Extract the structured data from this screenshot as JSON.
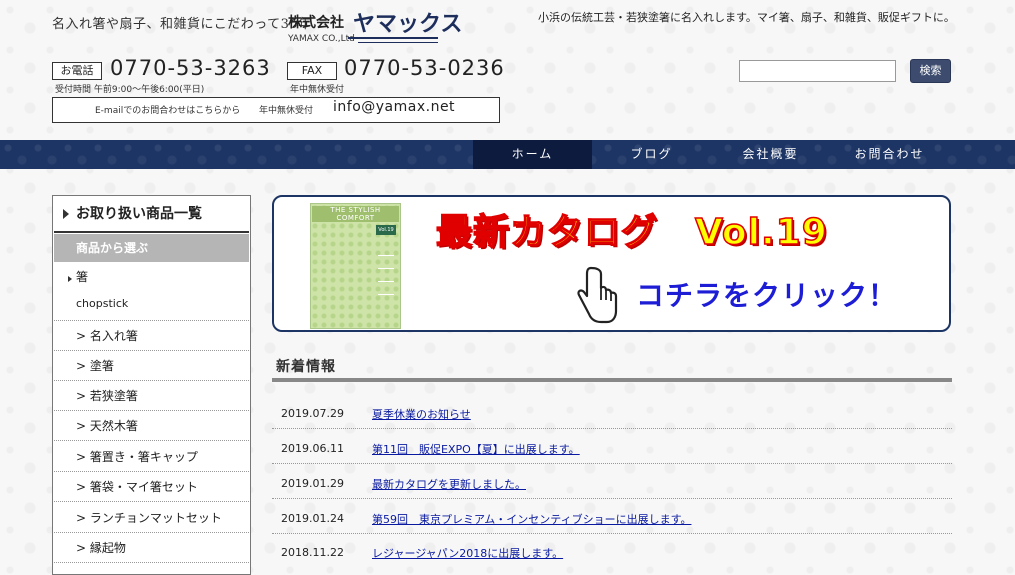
{
  "header": {
    "tagline_logo": "名入れ箸や扇子、和雑貨にこだわって35年",
    "company_prefix": "株式会社",
    "company_kana": "ヤマックス",
    "company_en": "YAMAX CO.,Ltd",
    "site_tagline": "小浜の伝統工芸・若狭塗箸に名入れします。マイ箸、扇子、和雑貨、販促ギフトに。",
    "tel_label": "お電話",
    "tel_number": "0770-53-3263",
    "tel_hours": "受付時間 午前9:00〜午後6:00(平日)",
    "fax_label": "FAX",
    "fax_number": "0770-53-0236",
    "fax_hours": "年中無休受付",
    "email_note": "E-mailでのお問合わせはこちらから",
    "email_hours": "年中無休受付",
    "email_address": "info@yamax.net",
    "search_button": "検索",
    "search_value": ""
  },
  "nav": {
    "items": [
      "ホーム",
      "ブログ",
      "会社概要",
      "お問合わせ"
    ]
  },
  "sidebar": {
    "heading": "お取り扱い商品一覧",
    "subheading": "商品から選ぶ",
    "category": "箸",
    "category_en": "chopstick",
    "items": [
      "> 名入れ箸",
      "> 塗箸",
      "> 若狭塗箸",
      "> 天然木箸",
      "> 箸置き・箸キャップ",
      "> 箸袋・マイ箸セット",
      "> ランチョンマットセット",
      "> 縁起物"
    ]
  },
  "banner": {
    "catalog_cover_title": "THE STYLISH COMFORT",
    "catalog_cover_vol": "Vol.19",
    "headline": "最新カタログ　Vol.19",
    "subline": "コチラをクリック！"
  },
  "news": {
    "heading": "新着情報",
    "entries": [
      {
        "date": "2019.07.29",
        "title": "夏季休業のお知らせ"
      },
      {
        "date": "2019.06.11",
        "title": "第11回　販促EXPO【夏】に出展します。"
      },
      {
        "date": "2019.01.29",
        "title": "最新カタログを更新しました。"
      },
      {
        "date": "2019.01.24",
        "title": "第59回　東京プレミアム・インセンティブショーに出展します。"
      },
      {
        "date": "2018.11.22",
        "title": "レジャージャパン2018に出展します。"
      }
    ]
  },
  "colors": {
    "nav_bg": "#1d3565",
    "nav_active": "#0d1b3f",
    "banner_headline": "#ffff00",
    "banner_subline": "#1d1dd6",
    "link": "#0a1aa0"
  }
}
